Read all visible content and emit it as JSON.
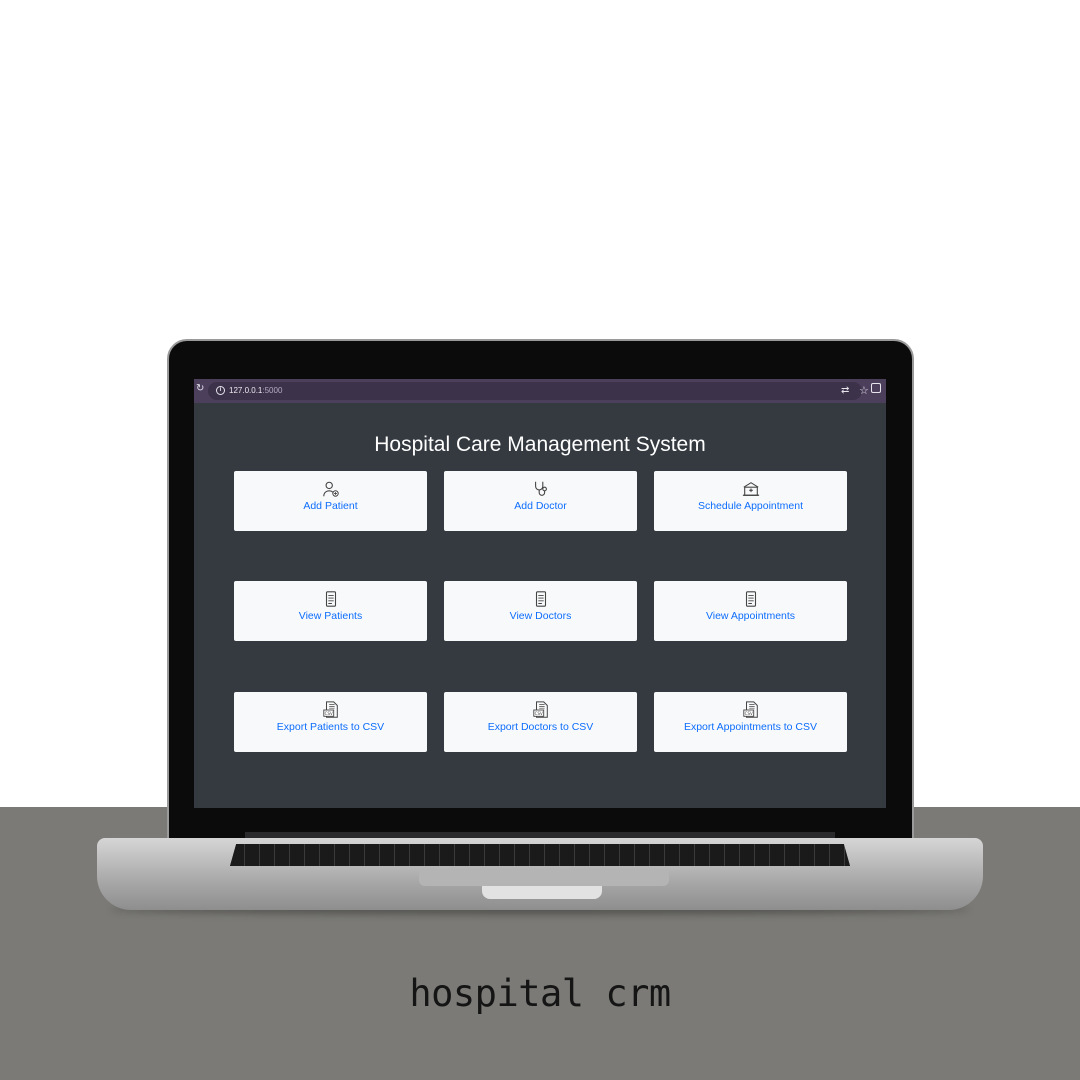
{
  "browser": {
    "url_host": "127.0.0.1",
    "url_port": ":5000"
  },
  "app": {
    "title": "Hospital Care Management System"
  },
  "cards": [
    {
      "label": "Add Patient",
      "icon": "patient-icon"
    },
    {
      "label": "Add Doctor",
      "icon": "stethoscope-icon"
    },
    {
      "label": "Schedule Appointment",
      "icon": "hospital-building-icon"
    },
    {
      "label": "View Patients",
      "icon": "document-icon"
    },
    {
      "label": "View Doctors",
      "icon": "document-icon"
    },
    {
      "label": "View Appointments",
      "icon": "document-icon"
    },
    {
      "label": "Export Patients to CSV",
      "icon": "csv-file-icon"
    },
    {
      "label": "Export Doctors to CSV",
      "icon": "csv-file-icon"
    },
    {
      "label": "Export Appointments to CSV",
      "icon": "csv-file-icon"
    }
  ],
  "caption": "hospital crm",
  "colors": {
    "screen_bg": "#343a40",
    "card_bg": "#f8f9fa",
    "link": "#0d6efd",
    "browser_bar": "#4b3f5c",
    "floor": "#7b7a76"
  }
}
